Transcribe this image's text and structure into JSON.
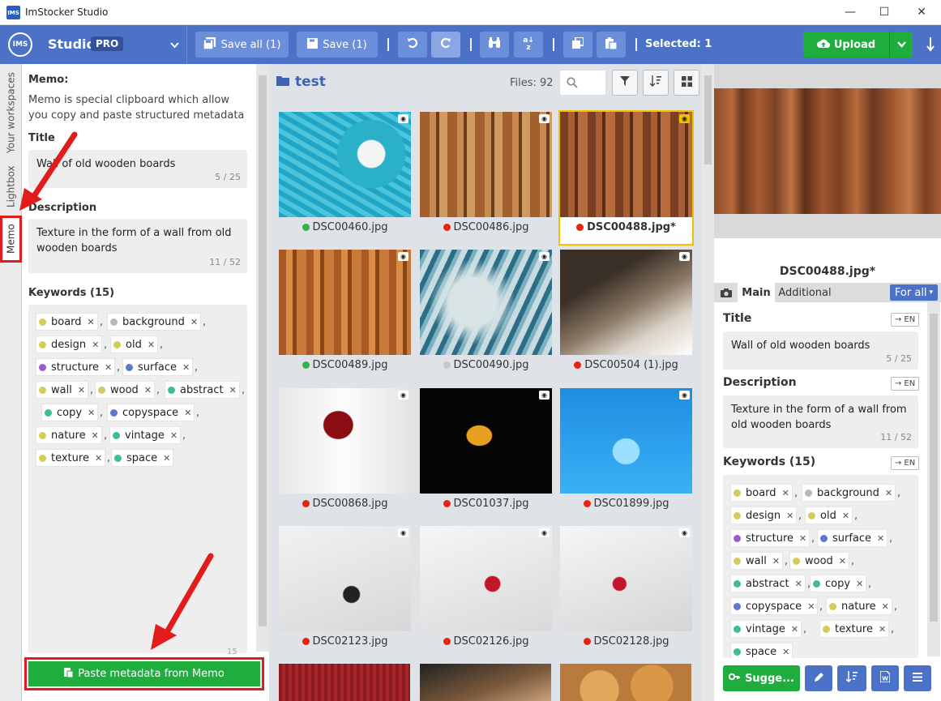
{
  "window": {
    "title": "ImStocker Studio",
    "logo_text": "IMS",
    "minimize": "—",
    "maximize": "☐",
    "close": "✕"
  },
  "toolbar": {
    "logo": "IMS",
    "studio": "Studio",
    "pro": "PRO",
    "save_all": "Save all (1)",
    "save": "Save (1)",
    "selected": "Selected: 1",
    "upload": "Upload"
  },
  "vtabs": {
    "workspaces": "Your workspaces",
    "lightbox": "Lightbox",
    "memo": "Memo"
  },
  "memo": {
    "heading": "Memo:",
    "intro": "Memo is special clipboard which allow you copy and paste structured metadata",
    "title_label": "Title",
    "title_value": "Wall of old wooden boards",
    "title_count": "5 / 25",
    "desc_label": "Description",
    "desc_value": "Texture in the form of a wall from old wooden boards",
    "desc_count": "11 / 52",
    "keywords_label": "Keywords (15)",
    "kw_count": "15",
    "paste_button": "Paste metadata from Memo"
  },
  "keywords": [
    {
      "text": "board",
      "color": "#d4cc5a"
    },
    {
      "text": "background",
      "color": "#b9b9b9"
    },
    {
      "text": "design",
      "color": "#d4cc5a"
    },
    {
      "text": "old",
      "color": "#d4cc5a"
    },
    {
      "text": "structure",
      "color": "#a15bd0"
    },
    {
      "text": "surface",
      "color": "#5a78d4"
    },
    {
      "text": "wall",
      "color": "#d4cc5a"
    },
    {
      "text": "wood",
      "color": "#d4cc5a"
    },
    {
      "text": "abstract",
      "color": "#3cbf8c"
    },
    {
      "text": "copy",
      "color": "#3cbf8c"
    },
    {
      "text": "copyspace",
      "color": "#5a78d4"
    },
    {
      "text": "nature",
      "color": "#d4cc5a"
    },
    {
      "text": "vintage",
      "color": "#3cbf8c"
    },
    {
      "text": "texture",
      "color": "#d4cc5a"
    },
    {
      "text": "space",
      "color": "#3cbf8c"
    }
  ],
  "browser": {
    "folder": "test",
    "files": "Files: 92"
  },
  "tiles": [
    {
      "name": "DSC00460.jpg",
      "status": "#2fb34a"
    },
    {
      "name": "DSC00486.jpg",
      "status": "#e5250f"
    },
    {
      "name": "DSC00488.jpg*",
      "status": "#e5250f"
    },
    {
      "name": "DSC00489.jpg",
      "status": "#2fb34a"
    },
    {
      "name": "DSC00490.jpg",
      "status": "#c8c8c8"
    },
    {
      "name": "DSC00504 (1).jpg",
      "status": "#e5250f"
    },
    {
      "name": "DSC00868.jpg",
      "status": "#e5250f"
    },
    {
      "name": "DSC01037.jpg",
      "status": "#e5250f"
    },
    {
      "name": "DSC01899.jpg",
      "status": "#e5250f"
    },
    {
      "name": "DSC02123.jpg",
      "status": "#e5250f"
    },
    {
      "name": "DSC02126.jpg",
      "status": "#e5250f"
    },
    {
      "name": "DSC02128.jpg",
      "status": "#e5250f"
    }
  ],
  "details": {
    "filename": "DSC00488.jpg*",
    "tab_main": "Main",
    "tab_additional": "Additional",
    "for_all": "For all",
    "title_label": "Title",
    "title_value": "Wall of old wooden boards",
    "title_count": "5 / 25",
    "desc_label": "Description",
    "desc_value": "Texture in the form of a wall from old wooden boards",
    "desc_count": "11 / 52",
    "keywords_label": "Keywords (15)",
    "en": "→ EN",
    "suggest": "Sugge..."
  },
  "colors": {
    "accent": "#4b72c6",
    "green": "#1fae3e",
    "highlight": "#e21b1b",
    "selected_outline": "#f3c000"
  }
}
